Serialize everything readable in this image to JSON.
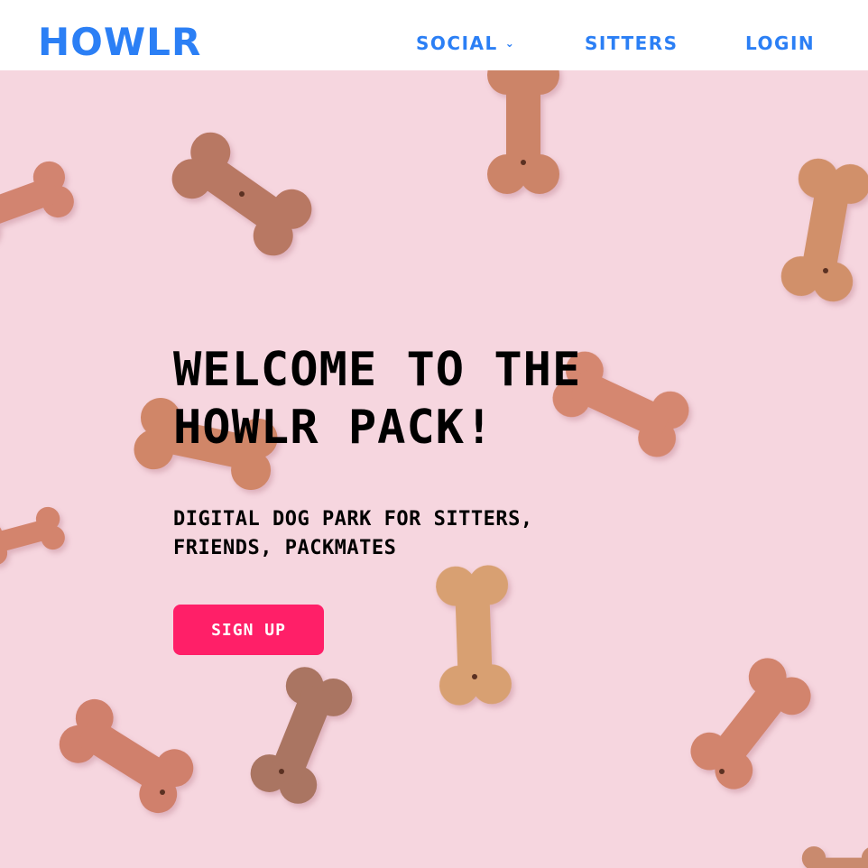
{
  "navbar": {
    "logo": "HOWLR",
    "links": {
      "social": "SOCIAL",
      "sitters": "SITTERS",
      "login": "LOGIN"
    },
    "brand_color": "#2b7ff5",
    "social_icon": "chevron-down-icon"
  },
  "hero": {
    "headline_line1": "WELCOME TO THE",
    "headline_line2": "HOWLR PACK!",
    "subline_line1": "DIGITAL DOG PARK FOR SITTERS,",
    "subline_line2": "FRIENDS, PACKMATES",
    "cta_label": "SIGN UP",
    "cta_color": "#ff1f68",
    "background_color": "#f6d6df",
    "background_image": "dog bone biscuits"
  }
}
